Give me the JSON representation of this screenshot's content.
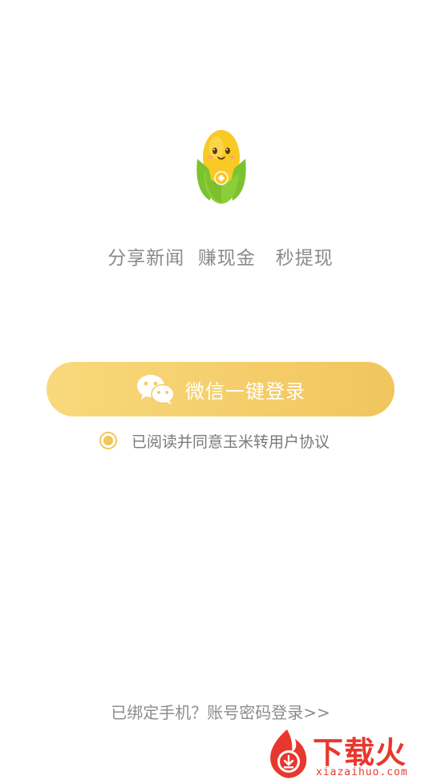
{
  "mascot": {
    "icon": "corn-mascot-icon"
  },
  "slogan": "分享新闻  赚现金   秒提现",
  "login": {
    "wechat_label": "微信一键登录",
    "wechat_icon": "wechat-icon"
  },
  "agreement": {
    "checked": true,
    "text": "已阅读并同意玉米转用户协议"
  },
  "alt_login": {
    "text": "已绑定手机？账号密码登录>>"
  },
  "watermark": {
    "title": "下载火",
    "url": "xiazaihuo.com",
    "icon": "download-flame-icon"
  },
  "colors": {
    "accent": "#f2c55d",
    "accent_light": "#f8d97c",
    "mascot_yellow": "#f9c925",
    "mascot_green": "#8ccd3a",
    "watermark_red": "#e8382e"
  }
}
